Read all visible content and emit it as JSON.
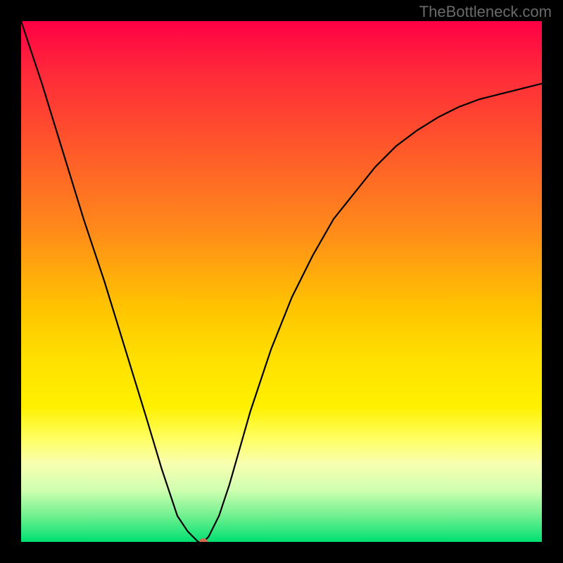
{
  "watermark": "TheBottleneck.com",
  "chart_data": {
    "type": "line",
    "title": "",
    "xlabel": "",
    "ylabel": "",
    "xlim": [
      0,
      100
    ],
    "ylim": [
      0,
      100
    ],
    "series": [
      {
        "name": "curve",
        "x": [
          0,
          4,
          8,
          12,
          16,
          20,
          24,
          27,
          30,
          32,
          34,
          35,
          36,
          38,
          40,
          44,
          48,
          52,
          56,
          60,
          64,
          68,
          72,
          76,
          80,
          84,
          88,
          92,
          96,
          100
        ],
        "y": [
          100,
          88,
          75,
          62,
          50,
          37,
          24,
          14,
          5,
          2,
          0,
          0,
          1,
          5,
          11,
          25,
          37,
          47,
          55,
          62,
          67,
          72,
          76,
          79,
          81.5,
          83.5,
          85,
          86,
          87,
          88
        ]
      }
    ],
    "marker": {
      "x": 35,
      "y": 0
    },
    "colors": {
      "gradient_top": "#ff0044",
      "gradient_bottom": "#00e070",
      "curve": "#000000",
      "marker": "#d46a4a",
      "background": "#000000"
    }
  }
}
